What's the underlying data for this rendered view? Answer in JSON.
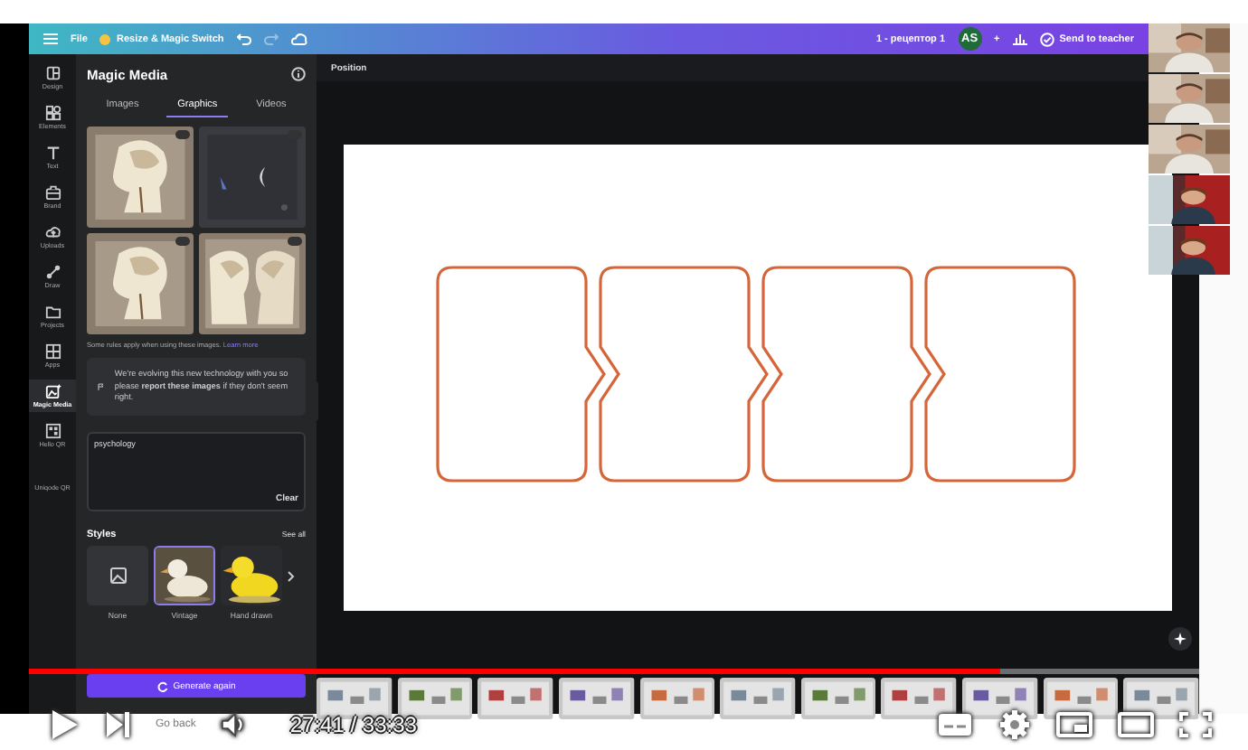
{
  "topbar": {
    "file": "File",
    "resize": "Resize & Magic Switch",
    "redo": {
      "disabled": true
    },
    "document_title": "1 - рецептор 1",
    "avatar": "AS",
    "add": "+",
    "send": "Send to teacher"
  },
  "rail": [
    {
      "label": "Design",
      "selected": false
    },
    {
      "label": "Elements",
      "selected": false
    },
    {
      "label": "Text",
      "selected": false
    },
    {
      "label": "Brand",
      "selected": false
    },
    {
      "label": "Uploads",
      "selected": false
    },
    {
      "label": "Draw",
      "selected": false
    },
    {
      "label": "Projects",
      "selected": false
    },
    {
      "label": "Apps",
      "selected": false
    },
    {
      "label": "Magic Media",
      "selected": true
    },
    {
      "label": "Hello QR",
      "selected": false
    },
    {
      "label": "Uniqode QR",
      "selected": false
    }
  ],
  "panel": {
    "title": "Magic Media",
    "tabs": [
      {
        "label": "Images",
        "selected": false
      },
      {
        "label": "Graphics",
        "selected": true
      },
      {
        "label": "Videos",
        "selected": false
      }
    ],
    "rules": "Some rules apply when using these images.",
    "learn_more": "Learn more",
    "notice": "We're evolving this new technology with you so please **report these images** if they don't seem right.",
    "prompt": "psychology",
    "clear": "Clear",
    "styles_title": "Styles",
    "see_all": "See all",
    "styles": [
      {
        "label": "None",
        "kind": "none",
        "selected": false
      },
      {
        "label": "Vintage",
        "kind": "picture",
        "selected": true
      },
      {
        "label": "Hand drawn",
        "kind": "picture",
        "selected": false
      }
    ],
    "generate": "Generate again"
  },
  "canvas": {
    "header": "Position",
    "shapes": [
      {
        "kind": "start"
      },
      {
        "kind": "middle"
      },
      {
        "kind": "middle"
      },
      {
        "kind": "end"
      }
    ]
  },
  "player": {
    "progress": {
      "level": 0.83
    },
    "hint": "Go back",
    "time": "27:41 / 33:33"
  }
}
